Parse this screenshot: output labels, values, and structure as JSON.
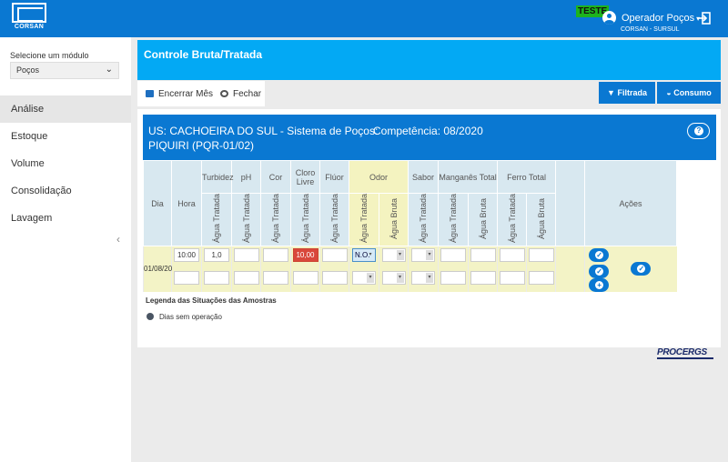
{
  "header": {
    "logo_text": "CORSAN",
    "env_badge": "TESTE",
    "user_name": "Operador Poços",
    "user_org": "CORSAN - SURSUL"
  },
  "sidebar": {
    "module_label": "Selecione um módulo",
    "module_value": "Poços",
    "items": [
      {
        "label": "Análise",
        "active": true
      },
      {
        "label": "Estoque"
      },
      {
        "label": "Volume"
      },
      {
        "label": "Consolidação"
      },
      {
        "label": "Lavagem"
      }
    ]
  },
  "page": {
    "title": "Controle Bruta/Tratada",
    "toolbar": {
      "encerrar": "Encerrar Mês",
      "fechar": "Fechar",
      "filtrada": "Filtrada",
      "consumo": "Consumo"
    }
  },
  "panel": {
    "unit_line": "US: CACHOEIRA DO SUL - Sistema de Poços:",
    "well_line": "PIQUIRI (PQR-01/02)",
    "competencia": "Competência: 08/2020",
    "columns": {
      "dia": "Dia",
      "hora": "Hora",
      "turbidez": "Turbidez",
      "ph": "pH",
      "cor": "Cor",
      "cloro": "Cloro Livre",
      "fluor": "Flúor",
      "odor": "Odor",
      "sabor": "Sabor",
      "manganes": "Manganês Total",
      "ferro": "Ferro Total",
      "acoes": "Ações",
      "agua_tratada": "Água Tratada",
      "agua_bruta": "Água Bruta"
    },
    "row": {
      "dia": "01/08/20",
      "hora": "10:00",
      "turbidez": "1,0",
      "cloro": "10,00",
      "odor": "N.O."
    },
    "legend_title": "Legenda das Situações das Amostras",
    "legend_item": "Dias sem operação"
  },
  "footer": {
    "brand": "PROCERGS"
  },
  "colors": {
    "primary": "#0a78d2",
    "header_light": "#03a9f4",
    "row_bg": "#f3f3c6",
    "alert": "#d9473b"
  }
}
